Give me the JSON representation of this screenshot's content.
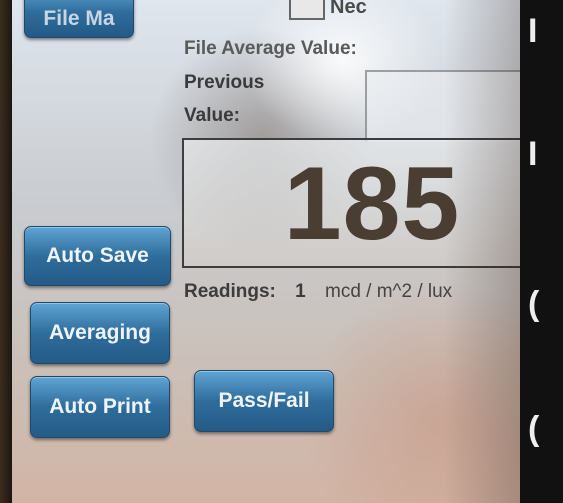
{
  "header": {
    "top_button_label": "File Ma",
    "top_box_value": "",
    "top_text": "Nec"
  },
  "fields": {
    "file_average_label": "File Average Value:",
    "previous_label_line1": "Previous",
    "previous_label_line2": "Value:"
  },
  "reading": {
    "value": "185",
    "readings_label": "Readings:",
    "readings_count": "1",
    "units": "mcd / m^2 / lux"
  },
  "buttons": {
    "auto_save": "Auto Save",
    "averaging": "Averaging",
    "auto_print": "Auto Print",
    "pass_fail": "Pass/Fail"
  },
  "colors": {
    "button_blue": "#2f6d9c",
    "reading_text": "#4a3d32"
  }
}
